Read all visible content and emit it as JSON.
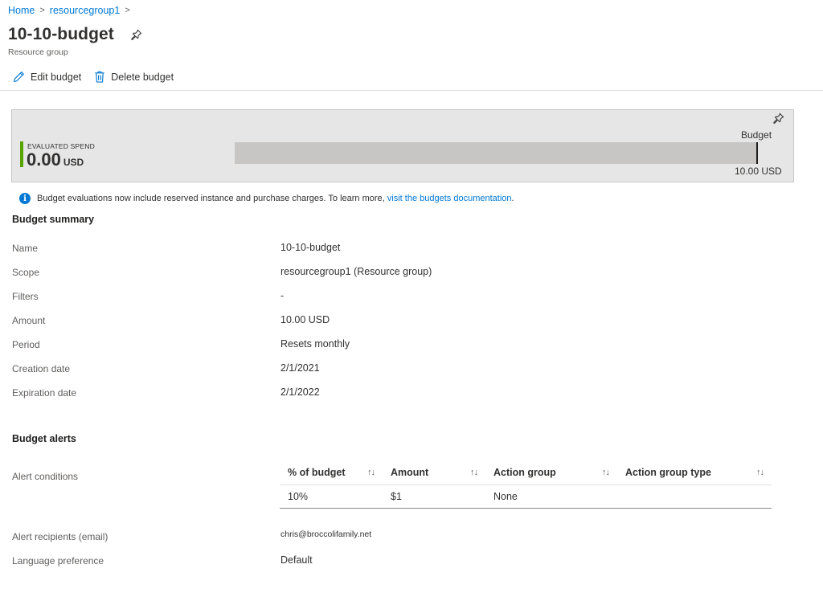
{
  "breadcrumb": {
    "home": "Home",
    "group": "resourcegroup1",
    "sep": ">"
  },
  "header": {
    "title": "10-10-budget",
    "subtitle": "Resource group"
  },
  "toolbar": {
    "edit_label": "Edit budget",
    "delete_label": "Delete budget"
  },
  "spend_card": {
    "label": "EVALUATED SPEND",
    "value": "0.00",
    "unit": "USD",
    "budget_label": "Budget",
    "budget_amount": "10.00 USD",
    "spend_fraction": 0.0
  },
  "info": {
    "text": "Budget evaluations now include reserved instance and purchase charges. To learn more, ",
    "link": "visit the budgets documentation",
    "suffix": "."
  },
  "summary": {
    "title": "Budget summary",
    "rows": [
      {
        "label": "Name",
        "value": "10-10-budget"
      },
      {
        "label": "Scope",
        "value": "resourcegroup1 (Resource group)"
      },
      {
        "label": "Filters",
        "value": "-"
      },
      {
        "label": "Amount",
        "value": "10.00 USD"
      },
      {
        "label": "Period",
        "value": "Resets monthly"
      },
      {
        "label": "Creation date",
        "value": "2/1/2021"
      },
      {
        "label": "Expiration date",
        "value": "2/1/2022"
      }
    ]
  },
  "alerts": {
    "title": "Budget alerts",
    "conditions_label": "Alert conditions",
    "columns": [
      "% of budget",
      "Amount",
      "Action group",
      "Action group type"
    ],
    "sort_glyph": "↑↓",
    "rows": [
      [
        "10%",
        "$1",
        "None",
        ""
      ]
    ],
    "recipients_label": "Alert recipients (email)",
    "recipients_value": "chris@broccolifamily.net",
    "language_label": "Language preference",
    "language_value": "Default"
  },
  "colors": {
    "accent": "#0078d4",
    "spend_bar": "#57a300",
    "card_bg": "#e6e6e6"
  },
  "icons": {
    "pin": "pin-icon",
    "edit": "pencil-icon",
    "delete": "trash-icon",
    "info": "info-icon"
  }
}
